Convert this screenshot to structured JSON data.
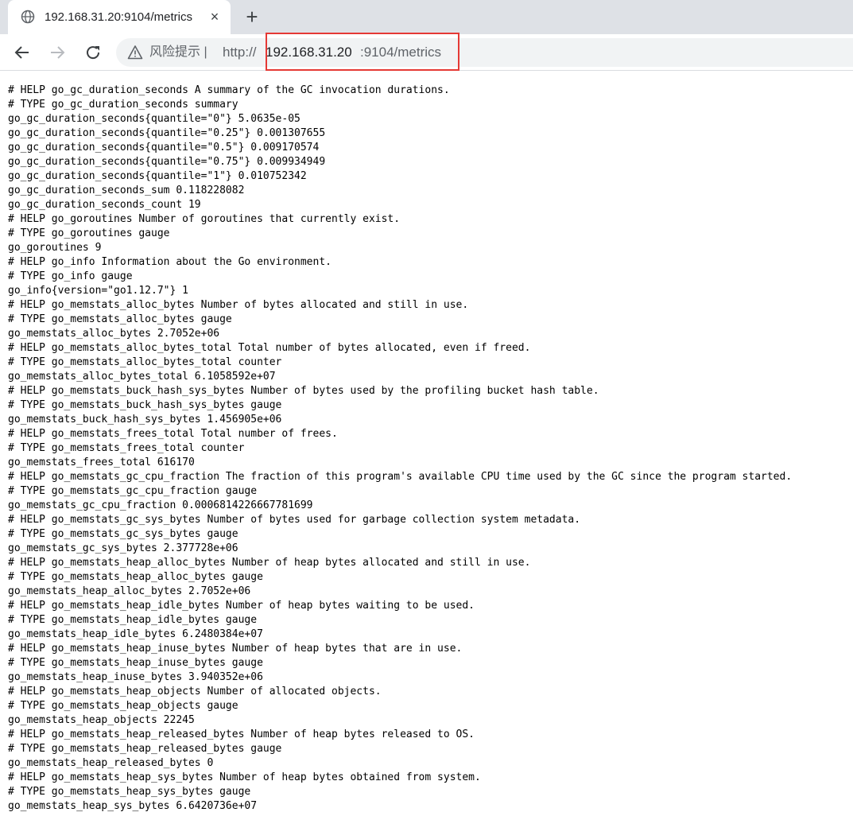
{
  "tab": {
    "title": "192.168.31.20:9104/metrics",
    "close_icon": "×",
    "new_tab_icon": "+"
  },
  "toolbar": {
    "risk_label": "风险提示  |",
    "url_scheme": "http://",
    "url_host": "192.168.31.20",
    "url_rest": ":9104/metrics",
    "highlight_color": "#e53935"
  },
  "content": {
    "lines": [
      "# HELP go_gc_duration_seconds A summary of the GC invocation durations.",
      "# TYPE go_gc_duration_seconds summary",
      "go_gc_duration_seconds{quantile=\"0\"} 5.0635e-05",
      "go_gc_duration_seconds{quantile=\"0.25\"} 0.001307655",
      "go_gc_duration_seconds{quantile=\"0.5\"} 0.009170574",
      "go_gc_duration_seconds{quantile=\"0.75\"} 0.009934949",
      "go_gc_duration_seconds{quantile=\"1\"} 0.010752342",
      "go_gc_duration_seconds_sum 0.118228082",
      "go_gc_duration_seconds_count 19",
      "# HELP go_goroutines Number of goroutines that currently exist.",
      "# TYPE go_goroutines gauge",
      "go_goroutines 9",
      "# HELP go_info Information about the Go environment.",
      "# TYPE go_info gauge",
      "go_info{version=\"go1.12.7\"} 1",
      "# HELP go_memstats_alloc_bytes Number of bytes allocated and still in use.",
      "# TYPE go_memstats_alloc_bytes gauge",
      "go_memstats_alloc_bytes 2.7052e+06",
      "# HELP go_memstats_alloc_bytes_total Total number of bytes allocated, even if freed.",
      "# TYPE go_memstats_alloc_bytes_total counter",
      "go_memstats_alloc_bytes_total 6.1058592e+07",
      "# HELP go_memstats_buck_hash_sys_bytes Number of bytes used by the profiling bucket hash table.",
      "# TYPE go_memstats_buck_hash_sys_bytes gauge",
      "go_memstats_buck_hash_sys_bytes 1.456905e+06",
      "# HELP go_memstats_frees_total Total number of frees.",
      "# TYPE go_memstats_frees_total counter",
      "go_memstats_frees_total 616170",
      "# HELP go_memstats_gc_cpu_fraction The fraction of this program's available CPU time used by the GC since the program started.",
      "# TYPE go_memstats_gc_cpu_fraction gauge",
      "go_memstats_gc_cpu_fraction 0.0006814226667781699",
      "# HELP go_memstats_gc_sys_bytes Number of bytes used for garbage collection system metadata.",
      "# TYPE go_memstats_gc_sys_bytes gauge",
      "go_memstats_gc_sys_bytes 2.377728e+06",
      "# HELP go_memstats_heap_alloc_bytes Number of heap bytes allocated and still in use.",
      "# TYPE go_memstats_heap_alloc_bytes gauge",
      "go_memstats_heap_alloc_bytes 2.7052e+06",
      "# HELP go_memstats_heap_idle_bytes Number of heap bytes waiting to be used.",
      "# TYPE go_memstats_heap_idle_bytes gauge",
      "go_memstats_heap_idle_bytes 6.2480384e+07",
      "# HELP go_memstats_heap_inuse_bytes Number of heap bytes that are in use.",
      "# TYPE go_memstats_heap_inuse_bytes gauge",
      "go_memstats_heap_inuse_bytes 3.940352e+06",
      "# HELP go_memstats_heap_objects Number of allocated objects.",
      "# TYPE go_memstats_heap_objects gauge",
      "go_memstats_heap_objects 22245",
      "# HELP go_memstats_heap_released_bytes Number of heap bytes released to OS.",
      "# TYPE go_memstats_heap_released_bytes gauge",
      "go_memstats_heap_released_bytes 0",
      "# HELP go_memstats_heap_sys_bytes Number of heap bytes obtained from system.",
      "# TYPE go_memstats_heap_sys_bytes gauge",
      "go_memstats_heap_sys_bytes 6.6420736e+07"
    ]
  }
}
